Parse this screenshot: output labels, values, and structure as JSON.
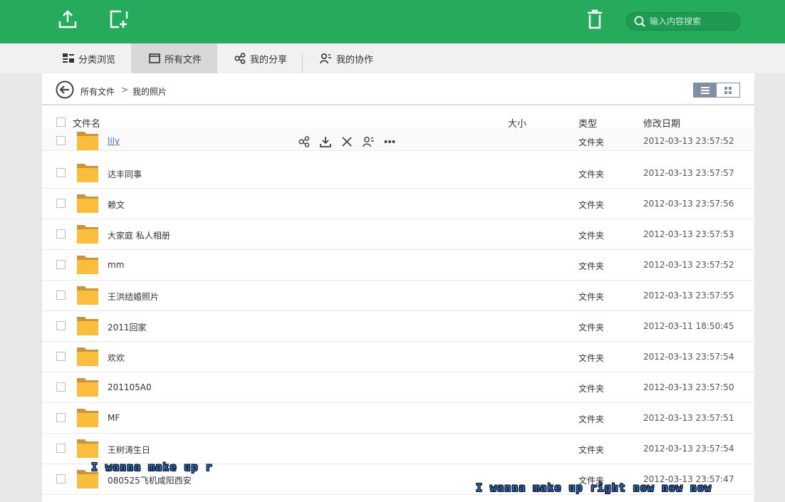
{
  "search": {
    "placeholder": "输入内容搜索"
  },
  "nav": {
    "tabs": [
      {
        "label": "分类浏览",
        "icon": "category-icon"
      },
      {
        "label": "所有文件",
        "icon": "folder-icon",
        "active": true
      },
      {
        "label": "我的分享",
        "icon": "share-icon"
      },
      {
        "label": "我的协作",
        "icon": "collaborate-icon"
      }
    ]
  },
  "breadcrumb": {
    "root": "所有文件",
    "separator": ">",
    "current": "我的照片"
  },
  "table": {
    "columns": {
      "name": "文件名",
      "size": "大小",
      "type": "类型",
      "date": "修改日期"
    },
    "rows": [
      {
        "name": "lily",
        "type": "文件夹",
        "date": "2012-03-13 23:57:52"
      },
      {
        "name": "达丰同事",
        "type": "文件夹",
        "date": "2012-03-13 23:57:57"
      },
      {
        "name": "赖文",
        "type": "文件夹",
        "date": "2012-03-13 23:57:56"
      },
      {
        "name": "大家庭 私人相册",
        "type": "文件夹",
        "date": "2012-03-13 23:57:53"
      },
      {
        "name": "mm",
        "type": "文件夹",
        "date": "2012-03-13 23:57:52"
      },
      {
        "name": "王洪结婚照片",
        "type": "文件夹",
        "date": "2012-03-13 23:57:55"
      },
      {
        "name": "2011回家",
        "type": "文件夹",
        "date": "2012-03-11 18:50:45"
      },
      {
        "name": "欢欢",
        "type": "文件夹",
        "date": "2012-03-13 23:57:54"
      },
      {
        "name": "201105A0",
        "type": "文件夹",
        "date": "2012-03-13 23:57:50"
      },
      {
        "name": "MF",
        "type": "文件夹",
        "date": "2012-03-13 23:57:51"
      },
      {
        "name": "王树涛生日",
        "type": "文件夹",
        "date": "2012-03-13 23:57:54"
      },
      {
        "name": "080525飞机咸阳西安",
        "type": "文件夹",
        "date": "2012-03-13 23:57:47"
      }
    ]
  },
  "overlay": {
    "lyric_1": "I wanna make up r",
    "lyric_2": "I wanna make up right now now now"
  },
  "colors": {
    "topbar": "#26ab5d",
    "folder": "#fbbd3c",
    "link": "#4a6fa5"
  }
}
